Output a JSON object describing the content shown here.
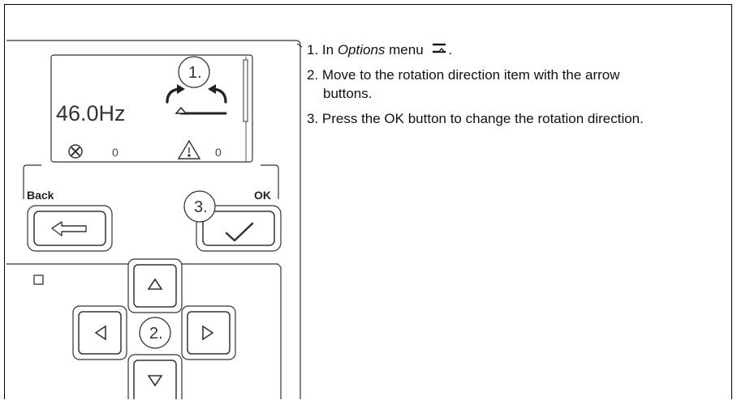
{
  "panel": {
    "frequency": "46.0Hz",
    "fault_count": "0",
    "warning_count": "0",
    "back_label": "Back",
    "ok_label": "OK",
    "callouts": [
      "1.",
      "2.",
      "3."
    ]
  },
  "instructions": {
    "step1_prefix": "1. In ",
    "step1_menu": "Options",
    "step1_suffix": " menu",
    "step1_end": ".",
    "step2_line1": "2. Move to the rotation direction item with the arrow",
    "step2_line2": "buttons.",
    "step3": "3. Press the OK button to change the rotation direction."
  },
  "icons": {
    "options_menu": "options-menu-icon",
    "rotation_direction": "rotation-direction-icon",
    "fault": "fault-icon",
    "warning": "warning-icon",
    "back_arrow": "back-arrow-icon",
    "checkmark": "checkmark-icon",
    "up": "arrow-up-icon",
    "down": "arrow-down-icon",
    "left": "arrow-left-icon",
    "right": "arrow-right-icon"
  }
}
